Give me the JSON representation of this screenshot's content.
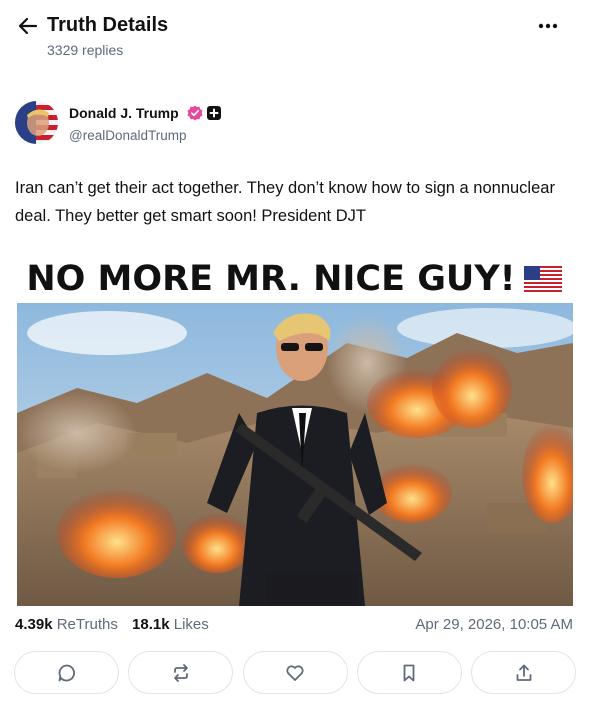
{
  "header": {
    "title": "Truth Details",
    "reply_count": "3329 replies"
  },
  "post": {
    "author": {
      "name": "Donald J. Trump",
      "handle": "@realDonaldTrump",
      "verified_color": "#e54b9a"
    },
    "text": "Iran can’t get their act together. They don’t know how to sign a nonnuclear deal. They better get smart soon! President DJT",
    "image": {
      "banner_text": "NO MORE MR. NICE GUY!",
      "banner_icon": "us-flag-icon"
    },
    "stats": {
      "retruths_count": "4.39k",
      "retruths_label": "ReTruths",
      "likes_count": "18.1k",
      "likes_label": "Likes"
    },
    "timestamp": "Apr 29, 2026, 10:05 AM"
  },
  "actions": [
    {
      "icon": "reply-icon"
    },
    {
      "icon": "retruth-icon"
    },
    {
      "icon": "like-icon"
    },
    {
      "icon": "bookmark-icon"
    },
    {
      "icon": "share-icon"
    }
  ],
  "colors": {
    "text_primary": "#121212",
    "text_secondary": "#606a7b",
    "border": "#e1e4ea"
  }
}
